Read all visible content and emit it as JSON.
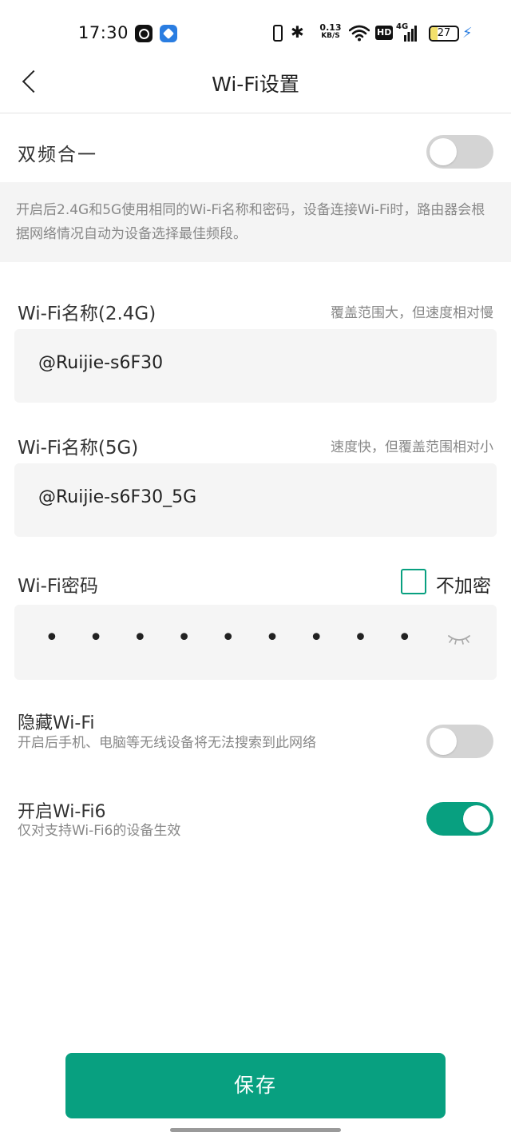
{
  "status_bar": {
    "time": "17:30",
    "net_speed_value": "0.13",
    "net_speed_unit": "KB/S",
    "hd_badge": "HD",
    "network_type": "4G",
    "battery_level": "27",
    "battery_fill_percent": 27,
    "icons": [
      "app-icon-1",
      "app-icon-2",
      "phone-icon",
      "bluetooth-icon",
      "wifi-icon",
      "signal-icon",
      "battery-icon",
      "charging-icon"
    ]
  },
  "header": {
    "title": "Wi-Fi设置"
  },
  "dual_band": {
    "label": "双频合一",
    "enabled": false,
    "description": "开启后2.4G和5G使用相同的Wi-Fi名称和密码，设备连接Wi-Fi时，路由器会根据网络情况自动为设备选择最佳频段。"
  },
  "wifi_24g": {
    "label": "Wi-Fi名称(2.4G)",
    "hint": "覆盖范围大，但速度相对慢",
    "value": "@Ruijie-s6F30"
  },
  "wifi_5g": {
    "label": "Wi-Fi名称(5G)",
    "hint": "速度快，但覆盖范围相对小",
    "value": "@Ruijie-s6F30_5G"
  },
  "password": {
    "label": "Wi-Fi密码",
    "no_encrypt_label": "不加密",
    "no_encrypt_checked": false,
    "masked_value": "• • • • • • • • •"
  },
  "hide_wifi": {
    "label": "隐藏Wi-Fi",
    "description": "开启后手机、电脑等无线设备将无法搜索到此网络",
    "enabled": false
  },
  "wifi6": {
    "label": "开启Wi-Fi6",
    "description": "仅对支持Wi-Fi6的设备生效",
    "enabled": true
  },
  "actions": {
    "save_label": "保存"
  },
  "colors": {
    "accent": "#08a080",
    "toggle_off": "#d4d4d4"
  }
}
